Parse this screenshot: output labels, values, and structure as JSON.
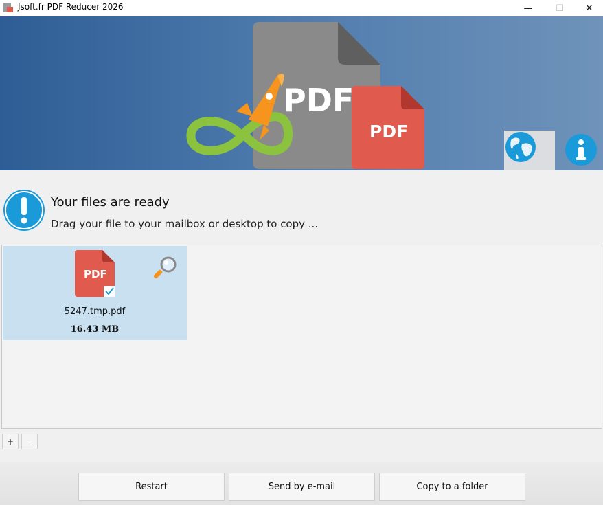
{
  "window": {
    "title": "Jsoft.fr PDF Reducer 2026",
    "minimize_glyph": "—",
    "maximize_glyph": "☐",
    "close_glyph": "✕"
  },
  "banner": {
    "logo_text": "PDF",
    "small_doc_text": "PDF",
    "icons": [
      "rocket-icon",
      "infinity-icon",
      "globe-icon",
      "info-icon"
    ]
  },
  "status": {
    "title": "Your files are ready",
    "subtitle": "Drag your file to your mailbox or desktop to copy ..."
  },
  "files": [
    {
      "icon_text": "PDF",
      "name": "5247.tmp.pdf",
      "size": "16.43 MB",
      "selected": true
    }
  ],
  "controls": {
    "plus": "+",
    "minus": "-"
  },
  "actions": {
    "restart": "Restart",
    "email": "Send by e-mail",
    "folder": "Copy to a folder"
  },
  "colors": {
    "pdf_red": "#e05a4e",
    "accent_blue": "#1a9ad8",
    "selection": "#c8e0f0",
    "green": "#8bc33f",
    "orange": "#f7941d"
  }
}
